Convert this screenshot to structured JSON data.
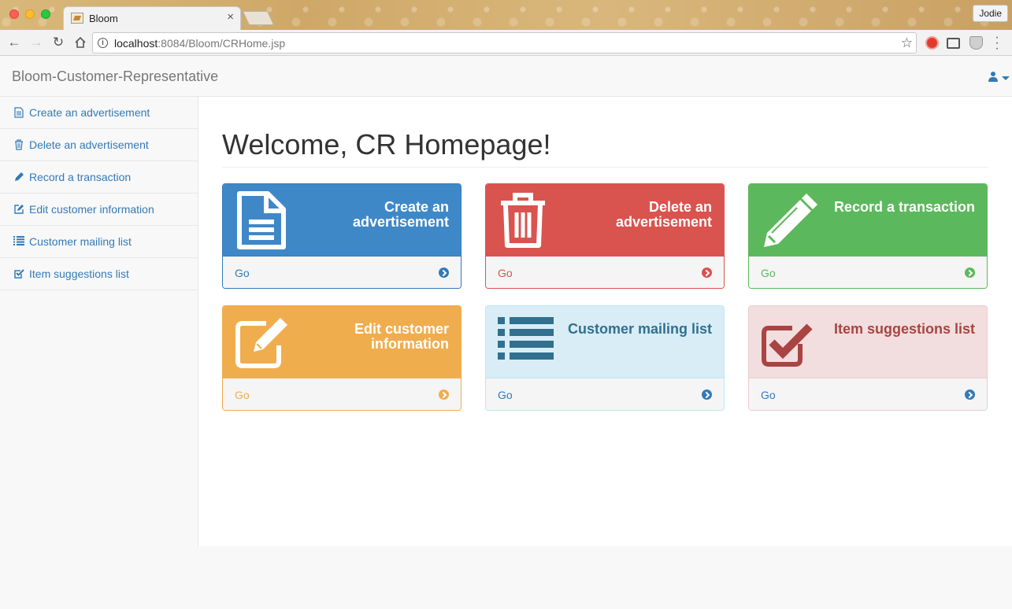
{
  "browser": {
    "tab_title": "Bloom",
    "tab_close": "×",
    "profile_name": "Jodie",
    "url_host": "localhost",
    "url_rest": ":8084/Bloom/CRHome.jsp",
    "icons": [
      "back-arrow-icon",
      "forward-arrow-icon",
      "reload-icon",
      "home-icon",
      "info-icon",
      "star-icon"
    ]
  },
  "navbar": {
    "brand": "Bloom-Customer-Representative",
    "user_menu_icon": "user-icon"
  },
  "sidebar": {
    "items": [
      {
        "label": "Create an advertisement",
        "icon": "file-icon"
      },
      {
        "label": "Delete an advertisement",
        "icon": "trash-icon"
      },
      {
        "label": "Record a transaction",
        "icon": "pencil-icon"
      },
      {
        "label": "Edit customer information",
        "icon": "edit-icon"
      },
      {
        "label": "Customer mailing list",
        "icon": "list-icon"
      },
      {
        "label": "Item suggestions list",
        "icon": "check-square-icon"
      }
    ]
  },
  "main": {
    "title": "Welcome, CR Homepage!",
    "panels": [
      {
        "title_line1": "Create an",
        "title_line2": "advertisement",
        "footer": "Go",
        "icon": "file-icon",
        "color": "#3f88c8"
      },
      {
        "title_line1": "Delete an",
        "title_line2": "advertisement",
        "footer": "Go",
        "icon": "trash-icon",
        "color": "#d9534f"
      },
      {
        "title_line1": "Record a transaction",
        "title_line2": "",
        "footer": "Go",
        "icon": "pencil-icon",
        "color": "#5cb85c"
      },
      {
        "title_line1": "Edit customer",
        "title_line2": "information",
        "footer": "Go",
        "icon": "edit-icon",
        "color": "#f0ad4e"
      },
      {
        "title_line1": "Customer mailing list",
        "title_line2": "",
        "footer": "Go",
        "icon": "list-icon",
        "color": "#d9edf7"
      },
      {
        "title_line1": "Item suggestions list",
        "title_line2": "",
        "footer": "Go",
        "icon": "check-square-icon",
        "color": "#f2dede"
      }
    ]
  }
}
